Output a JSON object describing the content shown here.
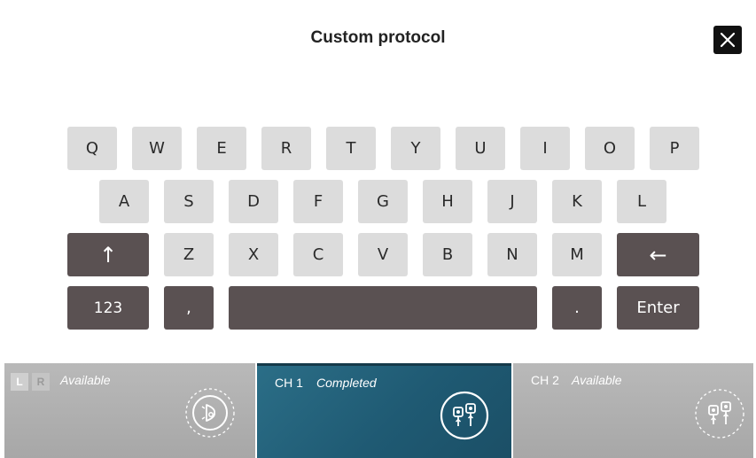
{
  "header": {
    "title": "Custom protocol"
  },
  "keyboard": {
    "row1": [
      "Q",
      "W",
      "E",
      "R",
      "T",
      "Y",
      "U",
      "I",
      "O",
      "P"
    ],
    "row2": [
      "A",
      "S",
      "D",
      "F",
      "G",
      "H",
      "J",
      "K",
      "L"
    ],
    "row3": [
      "Z",
      "X",
      "C",
      "V",
      "B",
      "N",
      "M"
    ],
    "shift_glyph": "↑",
    "backspace_glyph": "←",
    "numbers_label": "123",
    "comma_label": ",",
    "period_label": ".",
    "enter_label": "Enter"
  },
  "channels": {
    "left": {
      "badge_l": "L",
      "badge_r": "R",
      "status": "Available",
      "icon": "ear-probe-icon"
    },
    "ch1": {
      "label": "CH 1",
      "status": "Completed",
      "icon": "electrodes-icon"
    },
    "ch2": {
      "label": "CH 2",
      "status": "Available",
      "icon": "electrodes-icon"
    }
  },
  "colors": {
    "key_light": "#dcdcdc",
    "key_dark": "#5a5152",
    "active_panel": "#1f5a73",
    "inactive_panel": "#b0b0b0"
  }
}
